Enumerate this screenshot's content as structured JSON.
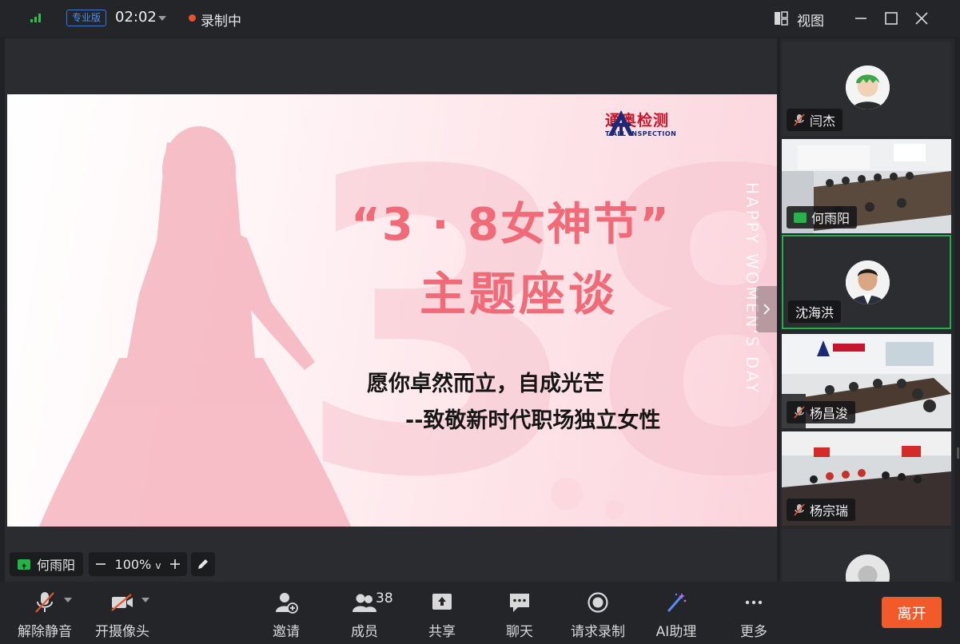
{
  "titlebar": {
    "edition_badge": "专业版",
    "timer": "02:02",
    "recording_label": "录制中",
    "view_label": "视图"
  },
  "slide": {
    "brand_name": "通奥检测",
    "brand_sub": "T-ALL INSPECTION",
    "title_line1": "“3 · 8女神节”",
    "title_line2": "主题座谈",
    "body_line1": "愿你卓然而立，自成光芒",
    "body_line2": "--致敬新时代职场独立女性",
    "vertical_text": "HAPPY WOMEN'S DAY"
  },
  "stage": {
    "presenter_name": "何雨阳",
    "zoom_level": "100%"
  },
  "participants": [
    {
      "name": "闫杰",
      "muted": true,
      "video": false
    },
    {
      "name": "何雨阳",
      "muted": false,
      "video": true,
      "sharing": true
    },
    {
      "name": "沈海洪",
      "muted": false,
      "video": false,
      "active_speaker": true
    },
    {
      "name": "杨昌浚",
      "muted": true,
      "video": true
    },
    {
      "name": "杨宗瑞",
      "muted": true,
      "video": true
    },
    {
      "name": "",
      "muted": false,
      "video": false
    }
  ],
  "toolbar": {
    "unmute_label": "解除静音",
    "camera_label": "开摄像头",
    "invite_label": "邀请",
    "members_label": "成员",
    "members_count": "38",
    "share_label": "共享",
    "chat_label": "聊天",
    "request_record_label": "请求录制",
    "ai_label": "AI助理",
    "more_label": "更多",
    "leave_label": "离开"
  },
  "colors": {
    "accent_green": "#1fb14a",
    "recording_red": "#e8532f",
    "leave_orange": "#f35a2a",
    "slide_title_pink": "#f16a78"
  }
}
